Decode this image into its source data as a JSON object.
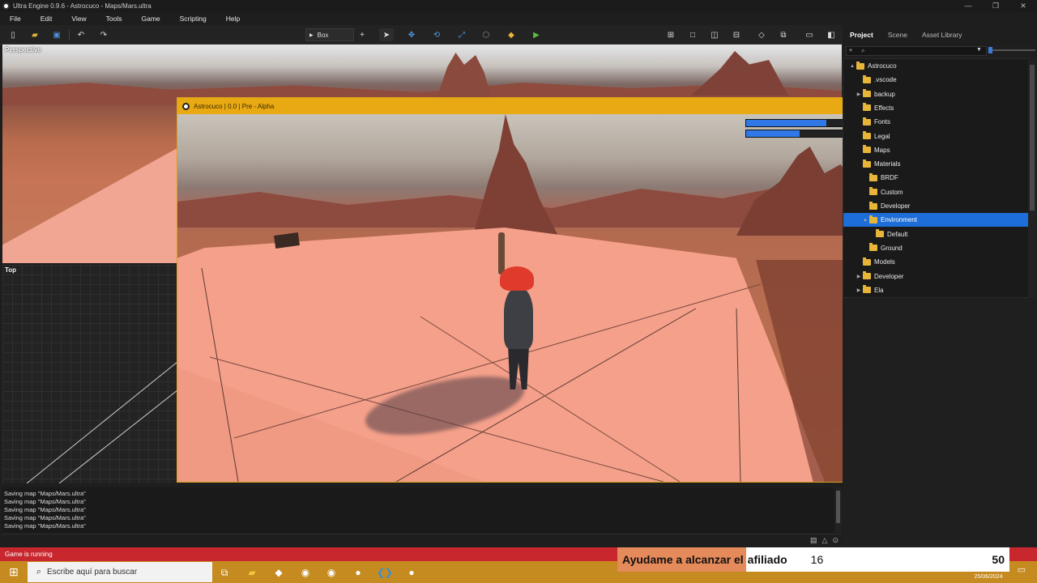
{
  "window": {
    "title": "Ultra Engine 0.9.6 - Astrocuco - Maps/Mars.ultra",
    "controls": [
      "—",
      "❐",
      "✕"
    ]
  },
  "menu": [
    "File",
    "Edit",
    "View",
    "Tools",
    "Game",
    "Scripting",
    "Help"
  ],
  "toolbar": {
    "brush_selector": "Box",
    "add_symbol": "+"
  },
  "right_tabs": {
    "project": "Project",
    "scene": "Scene",
    "asset_library": "Asset Library"
  },
  "viewports": {
    "perspective": "Perspective",
    "top": "Top"
  },
  "game_window": {
    "title": "Astrocuco | 0.0 | Pre - Alpha",
    "close": "✕",
    "hud_bars": [
      0.75,
      0.5
    ]
  },
  "console": {
    "lines": [
      "Saving map \"Maps/Mars.ultra\"",
      "Saving map \"Maps/Mars.ultra\"",
      "Saving map \"Maps/Mars.ultra\"",
      "Saving map \"Maps/Mars.ultra\"",
      "Saving map \"Maps/Mars.ultra\""
    ]
  },
  "project": {
    "search_value": "",
    "tree": [
      {
        "label": "Astrocuco",
        "depth": 0,
        "arrow": "▲"
      },
      {
        "label": ".vscode",
        "depth": 1,
        "arrow": ""
      },
      {
        "label": "backup",
        "depth": 1,
        "arrow": "▶"
      },
      {
        "label": "Effects",
        "depth": 1,
        "arrow": ""
      },
      {
        "label": "Fonts",
        "depth": 1,
        "arrow": ""
      },
      {
        "label": "Legal",
        "depth": 1,
        "arrow": ""
      },
      {
        "label": "Maps",
        "depth": 1,
        "arrow": ""
      },
      {
        "label": "Materials",
        "depth": 1,
        "arrow": ""
      },
      {
        "label": "BRDF",
        "depth": 2,
        "arrow": ""
      },
      {
        "label": "Custom",
        "depth": 2,
        "arrow": ""
      },
      {
        "label": "Developer",
        "depth": 2,
        "arrow": ""
      },
      {
        "label": "Environment",
        "depth": 2,
        "arrow": "▲",
        "selected": true
      },
      {
        "label": "Default",
        "depth": 3,
        "arrow": ""
      },
      {
        "label": "Ground",
        "depth": 2,
        "arrow": ""
      },
      {
        "label": "Models",
        "depth": 1,
        "arrow": ""
      },
      {
        "label": "Developer",
        "depth": 1,
        "arrow": "▶"
      },
      {
        "label": "Ela",
        "depth": 1,
        "arrow": "▶"
      }
    ]
  },
  "status": {
    "text": "Game is running"
  },
  "taskbar": {
    "search_placeholder": "Escribe aquí para buscar",
    "date": "25/06/2024"
  },
  "affiliate_widget": {
    "label_part1": "Ayudame a alcanzar el",
    "label_part2": "afiliado",
    "current": "16",
    "goal": "50"
  },
  "colors": {
    "accent": "#1d6ed8",
    "game_title_bar": "#e8a913",
    "status_bar": "#c8272e",
    "folder": "#e7b639"
  }
}
